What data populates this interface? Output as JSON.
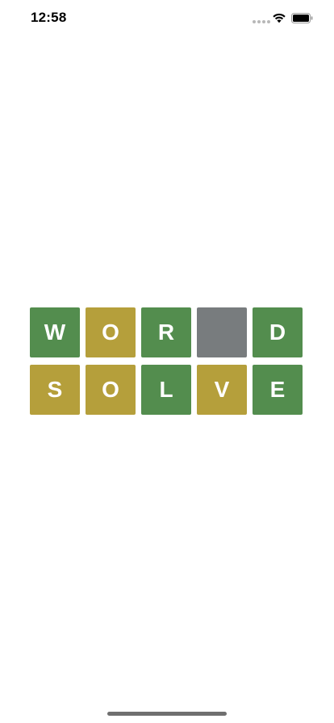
{
  "status_bar": {
    "time": "12:58",
    "icons": [
      "signal-dots-icon",
      "wifi-icon",
      "battery-icon"
    ]
  },
  "colors": {
    "correct": "#538d4e",
    "present": "#b59f3b",
    "absent": "#787c7e"
  },
  "board": {
    "rows": [
      {
        "tiles": [
          {
            "letter": "W",
            "state": "correct"
          },
          {
            "letter": "O",
            "state": "present"
          },
          {
            "letter": "R",
            "state": "correct"
          },
          {
            "letter": "",
            "state": "absent"
          },
          {
            "letter": "D",
            "state": "correct"
          }
        ]
      },
      {
        "tiles": [
          {
            "letter": "S",
            "state": "present"
          },
          {
            "letter": "O",
            "state": "present"
          },
          {
            "letter": "L",
            "state": "correct"
          },
          {
            "letter": "V",
            "state": "present"
          },
          {
            "letter": "E",
            "state": "correct"
          }
        ]
      }
    ]
  }
}
